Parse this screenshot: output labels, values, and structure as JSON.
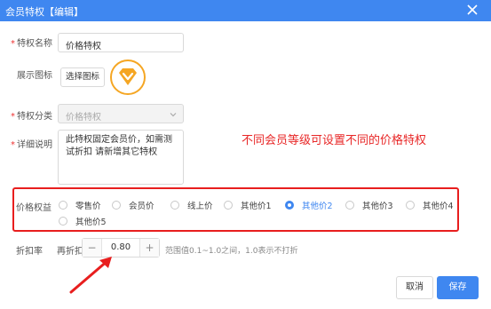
{
  "dialog": {
    "title": "会员特权【编辑】"
  },
  "form": {
    "name_label": "特权名称",
    "name_value": "价格特权",
    "icon_label": "展示图标",
    "icon_button": "选择图标",
    "category_label": "特权分类",
    "category_value": "价格特权",
    "desc_label": "详细说明",
    "desc_value": "此特权固定会员价，如需测试折扣 请新增其它特权",
    "price_label": "价格权益",
    "price_options": [
      {
        "label": "零售价",
        "selected": false
      },
      {
        "label": "会员价",
        "selected": false
      },
      {
        "label": "线上价",
        "selected": false
      },
      {
        "label": "其他价1",
        "selected": false
      },
      {
        "label": "其他价2",
        "selected": true
      },
      {
        "label": "其他价3",
        "selected": false
      },
      {
        "label": "其他价4",
        "selected": false
      },
      {
        "label": "其他价5",
        "selected": false
      }
    ],
    "discount_label": "折扣率",
    "discount_sub_label": "再折扣",
    "discount_value": "0.80",
    "discount_hint": "范围值0.1~1.0之间，1.0表示不打折"
  },
  "annotation": "不同会员等级可设置不同的价格特权",
  "footer": {
    "cancel": "取消",
    "save": "保存"
  },
  "colors": {
    "accent": "#3f87f0",
    "annotation_red": "#e82727",
    "icon_gold": "#f5a623"
  },
  "icons": {
    "close": "close-icon",
    "chevron": "chevron-down-icon",
    "diamond": "diamond-icon",
    "arrow": "annotation-arrow"
  }
}
